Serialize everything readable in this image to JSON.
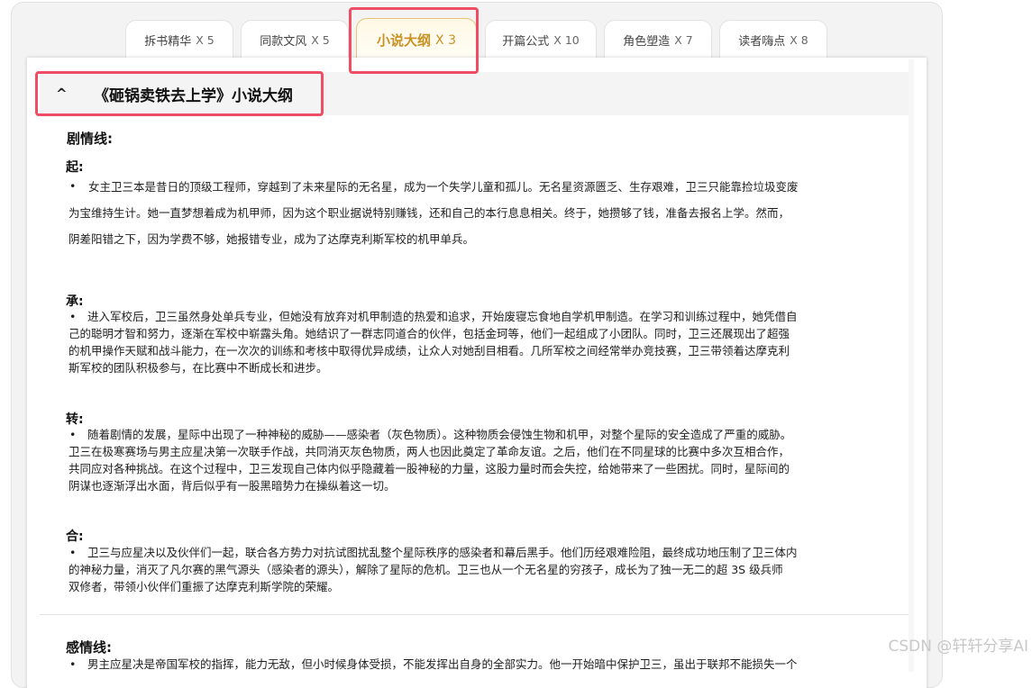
{
  "tabs": [
    {
      "label": "拆书精华",
      "count": "X 5"
    },
    {
      "label": "同款文风",
      "count": "X 5"
    },
    {
      "label": "小说大纲",
      "count": "X 3"
    },
    {
      "label": "开篇公式",
      "count": "X 10"
    },
    {
      "label": "角色塑造",
      "count": "X 7"
    },
    {
      "label": "读者嗨点",
      "count": "X 8"
    }
  ],
  "active_tab_index": 2,
  "outline": {
    "caret": "^",
    "title": "《砸锅卖铁去上学》小说大纲"
  },
  "plot": {
    "heading": "剧情线:",
    "stages": [
      {
        "label": "起:",
        "bullet": "•",
        "lines": [
          "女主卫三本是昔日的顶级工程师，穿越到了未来星际的无名星，成为一个失学儿童和孤儿。无名星资源匮乏、生存艰难，卫三只能靠捡垃圾变废",
          "为宝维持生计。她一直梦想着成为机甲师，因为这个职业据说特别赚钱，还和自己的本行息息相关。终于，她攒够了钱，准备去报名上学。然而，",
          "阴差阳错之下，因为学费不够，她报错专业，成为了达摩克利斯军校的机甲单兵。"
        ]
      },
      {
        "label": "承:",
        "bullet": "•",
        "lines": [
          "进入军校后，卫三虽然身处单兵专业，但她没有放弃对机甲制造的热爱和追求，开始废寝忘食地自学机甲制造。在学习和训练过程中，她凭借自",
          "己的聪明才智和努力，逐渐在军校中崭露头角。她结识了一群志同道合的伙伴，包括金珂等，他们一起组成了小团队。同时，卫三还展现出了超强",
          "的机甲操作天赋和战斗能力，在一次次的训练和考核中取得优异成绩，让众人对她刮目相看。几所军校之间经常举办竞技赛，卫三带领着达摩克利",
          "斯军校的团队积极参与，在比赛中不断成长和进步。"
        ]
      },
      {
        "label": "转:",
        "bullet": "•",
        "lines": [
          "随着剧情的发展，星际中出现了一种神秘的威胁——感染者（灰色物质）。这种物质会侵蚀生物和机甲，对整个星际的安全造成了严重的威胁。",
          "卫三在极寒赛场与男主应星决第一次联手作战，共同消灭灰色物质，两人也因此奠定了革命友谊。之后，他们在不同星球的比赛中多次互相合作，",
          "共同应对各种挑战。在这个过程中，卫三发现自己体内似乎隐藏着一股神秘的力量，这股力量时而会失控，给她带来了一些困扰。同时，星际间的",
          "阴谋也逐渐浮出水面，背后似乎有一股黑暗势力在操纵着这一切。"
        ]
      },
      {
        "label": "合:",
        "bullet": "•",
        "lines": [
          "卫三与应星决以及伙伴们一起，联合各方势力对抗试图扰乱整个星际秩序的感染者和幕后黑手。他们历经艰难险阻，最终成功地压制了卫三体内",
          "的神秘力量，消灭了凡尔赛的黑气源头（感染者的源头），解除了星际的危机。卫三也从一个无名星的穷孩子，成长为了独一无二的超 3S 级兵师",
          "双修者，带领小伙伴们重振了达摩克利斯学院的荣耀。"
        ]
      }
    ]
  },
  "emotion": {
    "heading": "感情线:",
    "bullet": "•",
    "line": "男主应星决是帝国军校的指挥，能力无敌，但小时候身体受损，不能发挥出自身的全部实力。他一开始暗中保护卫三，虽出于联邦不能损失一个"
  },
  "watermark": "CSDN @轩轩分享AI",
  "colors": {
    "active_tab": "#c99225",
    "highlight_box": "#ef4d64"
  }
}
